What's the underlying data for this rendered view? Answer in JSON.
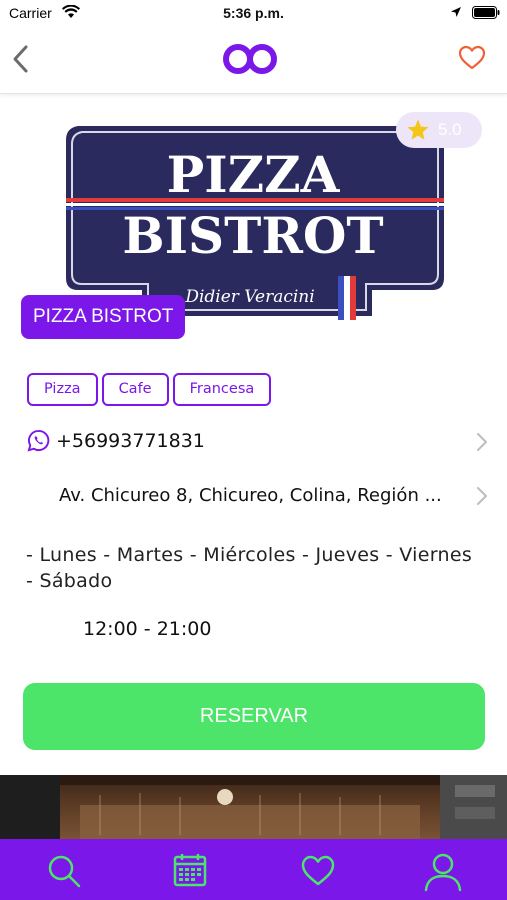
{
  "status_bar": {
    "carrier": "Carrier",
    "time": "5:36 p.m.",
    "icons": [
      "wifi-icon",
      "location-icon",
      "battery-icon"
    ]
  },
  "nav": {
    "back_icon": "chevron-left-icon",
    "logo_icon": "infinity-logo-icon",
    "favorite_icon": "heart-outline-icon"
  },
  "restaurant": {
    "logo": {
      "line1": "PIZZA",
      "line2": "BISTROT",
      "signature": "Didier Veracini"
    },
    "rating": "5.0",
    "name": "PIZZA BISTROT",
    "tags": [
      "Pizza",
      "Cafe",
      "Francesa"
    ],
    "phone": "+56993771831",
    "address": "Av. Chicureo 8, Chicureo, Colina, Región ...",
    "days_line1": "- Lunes - Martes - Miércoles - Jueves - Viernes",
    "days_line2": "- Sábado",
    "hours": "12:00 - 21:00"
  },
  "reserve_button": "RESERVAR",
  "tab_bar": {
    "items": [
      "search-icon",
      "calendar-icon",
      "heart-icon",
      "user-icon"
    ]
  },
  "colors": {
    "primary": "#7b17e8",
    "accent_green": "#4de46a",
    "tab_icon": "#4de46a",
    "heart": "#f0623a",
    "logo_navy": "#2a2a5e"
  }
}
